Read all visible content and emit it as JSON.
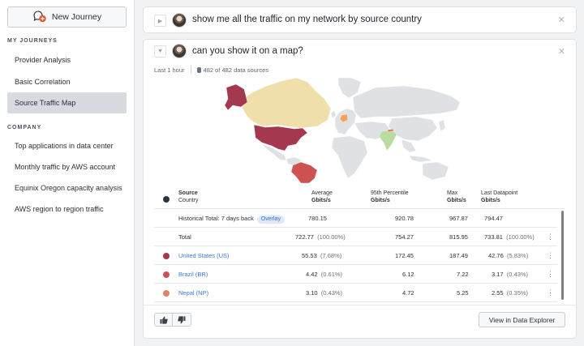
{
  "sidebar": {
    "new_journey_label": "New Journey",
    "my_journeys_title": "MY JOURNEYS",
    "journeys": [
      {
        "label": "Provider Analysis"
      },
      {
        "label": "Basic Correlation"
      },
      {
        "label": "Source Traffic Map",
        "active": true
      }
    ],
    "company_title": "COMPANY",
    "company_items": [
      {
        "label": "Top applications in data center"
      },
      {
        "label": "Monthly traffic by AWS account"
      },
      {
        "label": "Equinix Oregon capacity analysis"
      },
      {
        "label": "AWS region to region traffic"
      }
    ]
  },
  "queries": [
    {
      "text": "show me all the traffic on my network by source country",
      "expanded": false
    },
    {
      "text": "can you show it on a map?",
      "expanded": true
    }
  ],
  "icons": {
    "close": "close-icon",
    "expand": "chevron-right-icon",
    "collapse": "chevron-down-icon",
    "database": "database-icon",
    "kebab": "kebab-menu-icon",
    "thumbs_up": "thumbs-up-icon",
    "thumbs_down": "thumbs-down-icon"
  },
  "result": {
    "time_range": "Last 1 hour",
    "data_sources": "482 of 482 data sources",
    "map_colors": {
      "United States": "#a3384f",
      "Brazil": "#cf5252",
      "Nepal": "#e0836a",
      "Canada": "#f0dfaa",
      "Germany": "#f0a35b",
      "India": "#b9dca0",
      "other": "#dfe1e4"
    },
    "table": {
      "headers": {
        "source": "Source",
        "country": "Country",
        "avg": "Average",
        "avg_unit": "Gbits/s",
        "p95": "95th Percentile",
        "p95_unit": "Gbits/s",
        "max": "Max",
        "max_unit": "Gbits/s",
        "last": "Last Datapoint",
        "last_unit": "Gbits/s"
      },
      "historical": {
        "label": "Historical Total: 7 days back",
        "badge": "Overlay",
        "avg": "780.15",
        "p95": "920.78",
        "max": "967.87",
        "last": "794.47"
      },
      "total": {
        "label": "Total",
        "avg": "722.77",
        "avg_pct": "(100.00%)",
        "p95": "754.27",
        "max": "815.95",
        "last": "733.81",
        "last_pct": "(100.00%)"
      },
      "rows": [
        {
          "country": "United States (US)",
          "color": "#a3384f",
          "avg": "55.53",
          "avg_pct": "(7.68%)",
          "p95": "172.45",
          "max": "187.49",
          "last": "42.76",
          "last_pct": "(5.83%)"
        },
        {
          "country": "Brazil (BR)",
          "color": "#cf5252",
          "avg": "4.42",
          "avg_pct": "(0.61%)",
          "p95": "6.12",
          "max": "7.22",
          "last": "3.17",
          "last_pct": "(0.43%)"
        },
        {
          "country": "Nepal (NP)",
          "color": "#e0836a",
          "avg": "3.10",
          "avg_pct": "(0.43%)",
          "p95": "4.72",
          "max": "5.25",
          "last": "2.55",
          "last_pct": "(0.35%)"
        }
      ]
    },
    "view_button": "View in Data Explorer"
  }
}
